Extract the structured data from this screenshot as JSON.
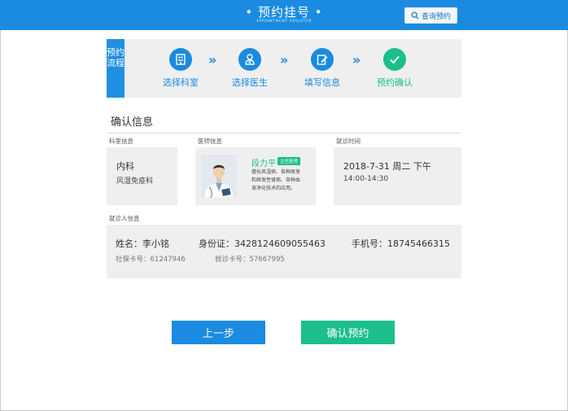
{
  "header": {
    "title": "• 预约挂号 •",
    "subtitle": "APPOINTMENT REGISTER",
    "query_button": "查询预约",
    "query_icon": "search-icon",
    "color": "#1a8be0"
  },
  "steps": {
    "side_label": "预约流程",
    "items": [
      {
        "label": "选择科室",
        "icon": "building-icon",
        "status": "active"
      },
      {
        "label": "选择医生",
        "icon": "doctor-icon",
        "status": "active"
      },
      {
        "label": "填写信息",
        "icon": "edit-icon",
        "status": "active"
      },
      {
        "label": "预约确认",
        "icon": "check-icon",
        "status": "done"
      }
    ],
    "arrow": "»"
  },
  "confirm": {
    "title": "确认信息",
    "department": {
      "label": "科室信息",
      "main": "内科",
      "sub": "风湿免疫科"
    },
    "doctor": {
      "label": "医师信息",
      "name": "段力平",
      "title": "主任医师",
      "desc_lines": [
        "擅长风湿病、各种原发",
        "和继发性肾病、各种血",
        "液净化技术的应用。"
      ]
    },
    "time": {
      "label": "就诊时间",
      "date": "2018-7-31 周二   下午",
      "range": "14:00-14:30"
    },
    "patient": {
      "label": "就诊人信息",
      "name": "姓名：李小铭",
      "id_card": "身份证：3428124609055463",
      "phone": "手机号：18745466315",
      "insurance": "社保卡号：61247946",
      "visit_card": "就诊卡号：57667995"
    }
  },
  "buttons": {
    "prev": "上一步",
    "confirm": "确认预约"
  },
  "colors": {
    "primary": "#1a8be0",
    "success": "#1bbf8b",
    "panel": "#efefef"
  }
}
